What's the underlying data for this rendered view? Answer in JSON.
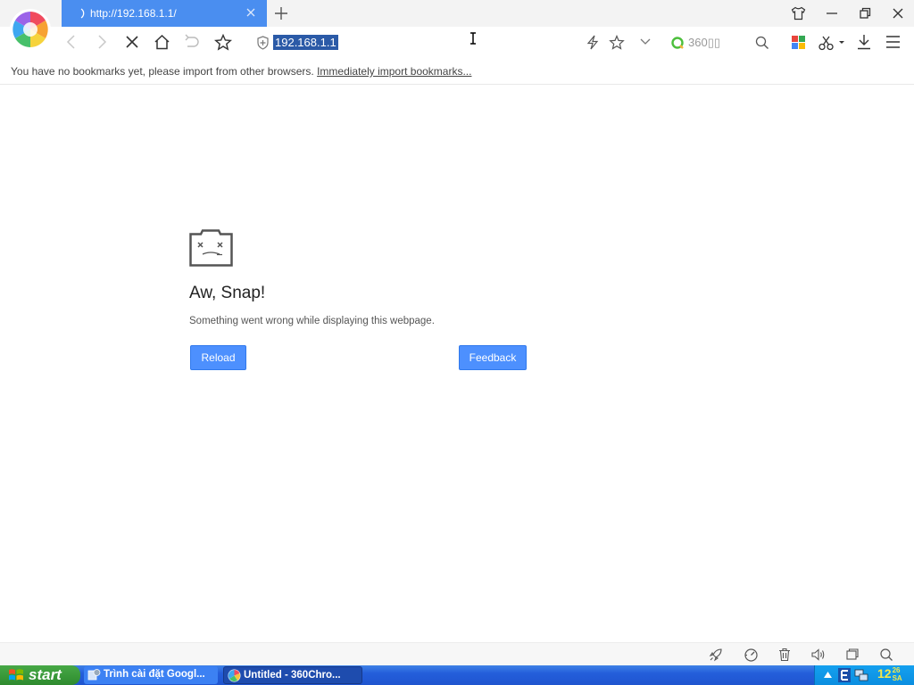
{
  "tab": {
    "title": "http://192.168.1.1/"
  },
  "toolbar": {
    "url": "192.168.1.1",
    "search_engine_label": "360▯▯"
  },
  "bookmarks_bar": {
    "message": "You have no bookmarks yet, please import from other browsers.",
    "import_link": "Immediately import bookmarks..."
  },
  "error_page": {
    "title": "Aw, Snap!",
    "message": "Something went wrong while displaying this webpage.",
    "reload_button": "Reload",
    "feedback_button": "Feedback"
  },
  "taskbar": {
    "start_label": "start",
    "tasks": [
      {
        "label": "Trình cài đặt Googl...",
        "icon": "installer-icon",
        "active": false
      },
      {
        "label": "Untitled - 360Chro...",
        "icon": "360-chrome-icon",
        "active": true
      }
    ],
    "clock_text": "12",
    "clock_small_top": "26",
    "clock_small_bottom": "SA"
  },
  "colors": {
    "tab_active": "#4a8ef0",
    "button_blue": "#4d90fe",
    "url_selection": "#2b5aa7",
    "taskbar_blue": "#245edb",
    "start_green": "#3a9a3a"
  }
}
